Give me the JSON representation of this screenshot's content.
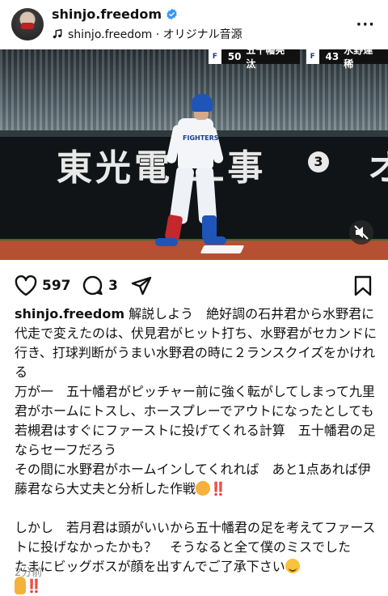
{
  "header": {
    "username": "shinjo.freedom",
    "subline": "shinjo.freedom · オリジナル音源"
  },
  "video": {
    "scorebug": {
      "team1": "F",
      "num1": "50",
      "name1": "五十幡亮汰",
      "team2": "F",
      "num2": "43",
      "name2": "水野達稀"
    },
    "wall_text": "東光電 工事",
    "wall_number": "3",
    "wall_right": "オ",
    "uniform_text": "FIGHTERS"
  },
  "actions": {
    "likes": "597",
    "comments": "3"
  },
  "caption": {
    "username": "shinjo.freedom",
    "p1": "解説しよう　絶好調の石井君から水野君に代走で変えたのは、伏見君がヒット打ち、水野君がセカンドに行き、打球判断がうまい水野君の時に２ランスクイズをかけれる",
    "p2": "万が一　五十幡君がピッチャー前に強く転がしてしまって九里君がホームにトスし、ホースプレーでアウトになったとしても若槻君はすぐにファーストに投げてくれる計算　五十幡君の足ならセーフだろう",
    "p3": "その間に水野君がホームインしてくれれば　あと1点あれば伊藤君なら大丈夫と分析した作戦",
    "p4": "しかし　若月君は頭がいいから五十幡君の足を考えてファーストに投げなかったかも？　そうなると全て僕のミスでした　　　　たまにビッグボスが顔を出すんでご了承下さい",
    "bangs": "‼️"
  },
  "timestamp": "2分前"
}
